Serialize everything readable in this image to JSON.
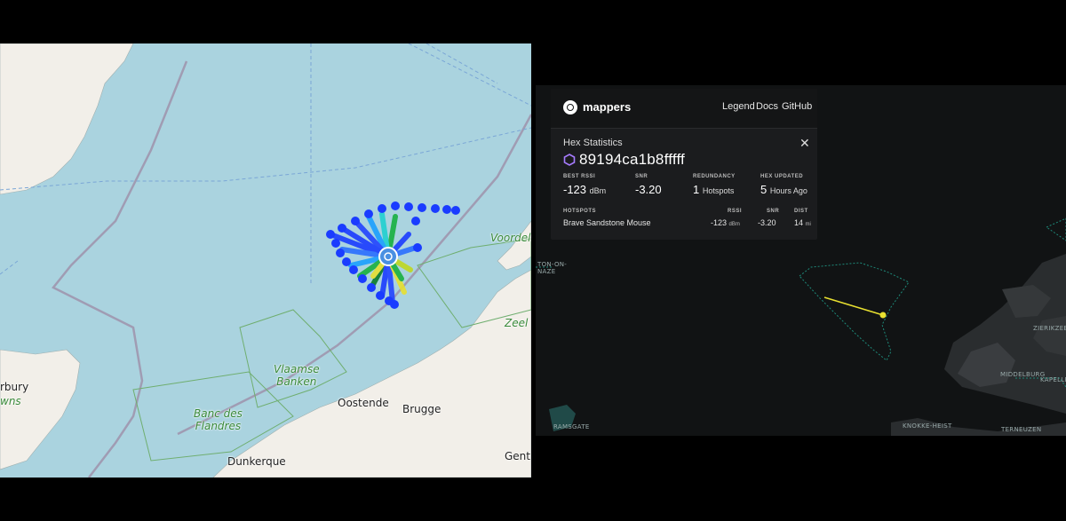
{
  "left_map": {
    "labels": {
      "voordelta": "Voordelt",
      "zeeland": "Zeel",
      "vlaamse_banken": "Vlaamse\nBanken",
      "banc_des_flandres": "Banc des\nFlandres",
      "oostende": "Oostende",
      "brugge": "Brugge",
      "dunkerque": "Dunkerque",
      "gent": "Gent",
      "canterbury": "rbury",
      "downs": "wns"
    },
    "colors": {
      "sea": "#aad3df",
      "land": "#f2efe9",
      "border": "#9e8fa8"
    }
  },
  "right_map": {
    "labels": {
      "clacton": "TON-ON-\nNAZE",
      "ramsgate": "RAMSGATE",
      "knokke": "KNOKKE-HEIST",
      "terneuzen": "TERNEUZEN",
      "middelburg": "MIDDELBURG",
      "zierikzee": "ZIERIKZEE",
      "kapelle": "KAPELLE"
    }
  },
  "panel": {
    "logo": "mappers",
    "nav": {
      "legend": "Legend",
      "docs": "Docs",
      "github": "GitHub"
    },
    "title": "Hex Statistics",
    "hex_id": "89194ca1b8fffff",
    "stats": {
      "best_rssi_label": "BEST RSSI",
      "best_rssi_value": "-123",
      "best_rssi_unit": "dBm",
      "snr_label": "SNR",
      "snr_value": "-3.20",
      "redundancy_label": "REDUNDANCY",
      "redundancy_value": "1",
      "redundancy_unit": "Hotspots",
      "hex_updated_label": "HEX UPDATED",
      "hex_updated_value": "5",
      "hex_updated_unit": "Hours Ago"
    },
    "hotspots": {
      "header": "HOTSPOTS",
      "rssi_header": "RSSI",
      "snr_header": "SNR",
      "dist_header": "DIST",
      "rows": [
        {
          "name": "Brave Sandstone Mouse",
          "rssi": "-123",
          "rssi_unit": "dBm",
          "snr": "-3.20",
          "dist": "14",
          "dist_unit": "mi"
        }
      ]
    },
    "colors": {
      "accent_hex": "#a77cff",
      "line": "#e8e030"
    }
  }
}
